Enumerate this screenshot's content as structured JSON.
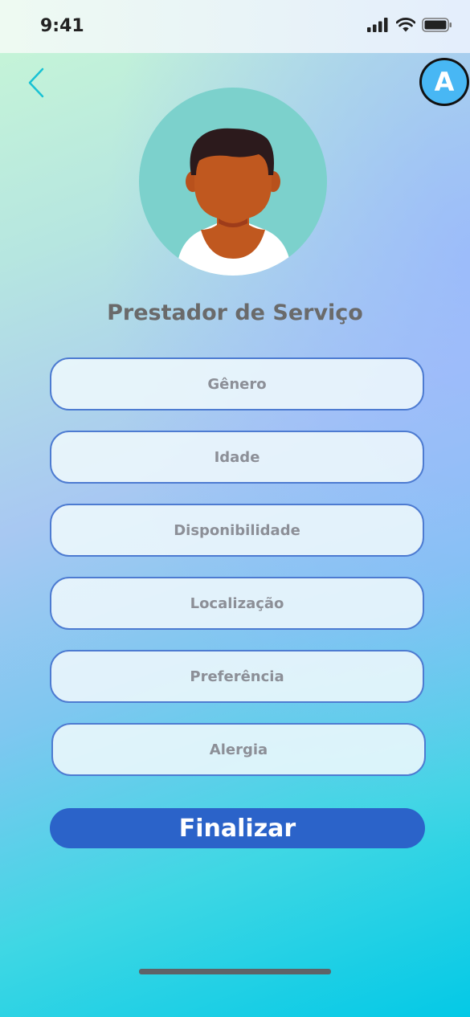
{
  "status_bar": {
    "time": "9:41"
  },
  "header": {
    "badge_letter": "A"
  },
  "profile": {
    "title": "Prestador de Serviço"
  },
  "fields": [
    {
      "label": "Gênero"
    },
    {
      "label": "Idade"
    },
    {
      "label": "Disponibilidade"
    },
    {
      "label": "Localização"
    },
    {
      "label": "Preferência"
    },
    {
      "label": "Alergia"
    }
  ],
  "actions": {
    "finalize_label": "Finalizar"
  },
  "colors": {
    "accent": "#2b63c9",
    "field_border": "#4d7bd1",
    "badge": "#48b7f4",
    "avatar_bg": "#7cd1cc",
    "back_arrow": "#19c2d4"
  },
  "icons": [
    "signal-icon",
    "wifi-icon",
    "battery-icon",
    "back-arrow-icon"
  ]
}
